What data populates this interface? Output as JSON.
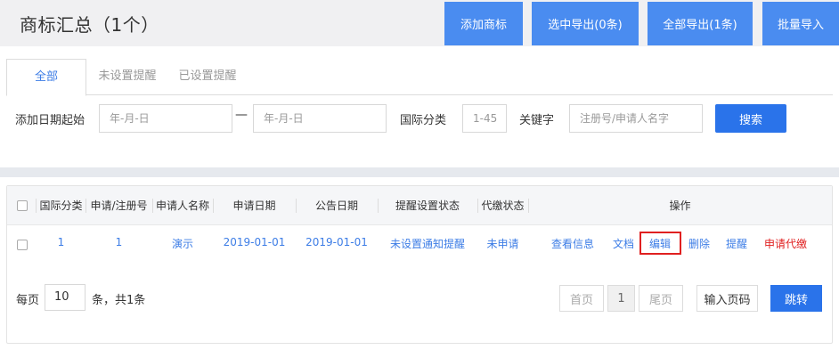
{
  "header": {
    "title": "商标汇总（1个）",
    "buttons": {
      "add_trademark": "添加商标",
      "export_selected": "选中导出(0条)",
      "export_all": "全部导出(1条)",
      "batch_import": "批量导入"
    }
  },
  "tabs": {
    "all": "全部",
    "not_set": "未设置提醒",
    "already_set": "已设置提醒"
  },
  "filters": {
    "date_label": "添加日期起始",
    "date_start_placeholder": "年-月-日",
    "date_separator": "—",
    "date_end_placeholder": "年-月-日",
    "class_label": "国际分类",
    "class_placeholder": "1-45",
    "keyword_label": "关键字",
    "keyword_placeholder": "注册号/申请人名字",
    "search_button": "搜索"
  },
  "table": {
    "headers": {
      "intl_class": "国际分类",
      "reg_no": "申请/注册号",
      "applicant": "申请人名称",
      "apply_date": "申请日期",
      "announce_date": "公告日期",
      "reminder_status": "提醒设置状态",
      "payment_status": "代缴状态",
      "actions": "操作"
    },
    "rows": [
      {
        "intl_class": "1",
        "reg_no": "1",
        "applicant": "演示",
        "apply_date": "2019-01-01",
        "announce_date": "2019-01-01",
        "reminder_status": "未设置通知提醒",
        "payment_status": "未申请",
        "actions": {
          "view": "查看信息",
          "docs": "文档",
          "edit": "编辑",
          "delete": "删除",
          "remind": "提醒",
          "apply_payment": "申请代缴"
        }
      }
    ]
  },
  "pagination": {
    "per_page_label": "每页",
    "per_page_value": "10",
    "total_text": "条，共1条",
    "first": "首页",
    "current_page": "1",
    "last": "尾页",
    "page_input_placeholder": "输入页码",
    "jump": "跳转"
  },
  "colors": {
    "primary_button": "#4a8cf0",
    "search_button": "#2a73ea",
    "link": "#3d7de6",
    "danger": "#e02020"
  }
}
